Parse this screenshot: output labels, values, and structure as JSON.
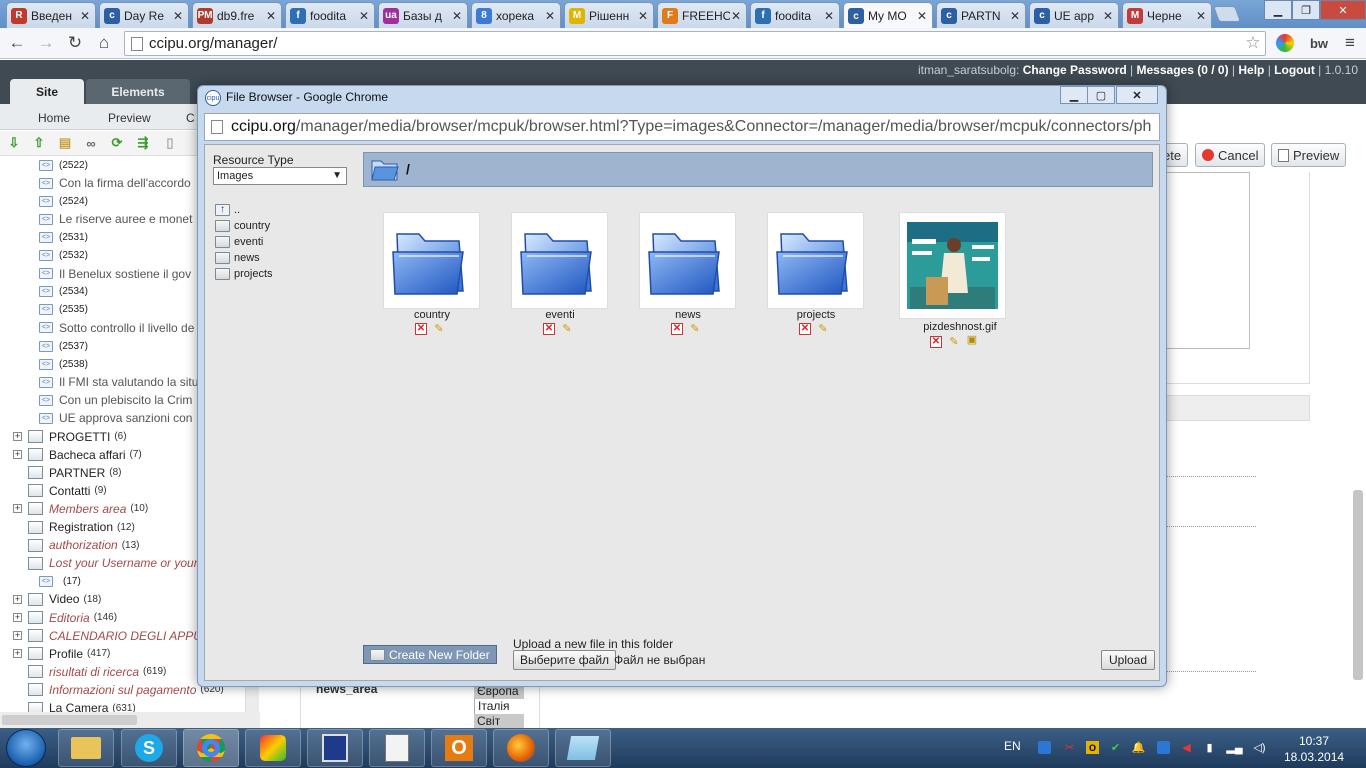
{
  "browser": {
    "tabs": [
      {
        "label": "Введен",
        "fav": "R",
        "color": "#c0392b"
      },
      {
        "label": "Day Re",
        "fav": "c",
        "color": "#2d5fa3"
      },
      {
        "label": "db9.fre",
        "fav": "РМ",
        "color": "#b03a2e"
      },
      {
        "label": "foodita",
        "fav": "f",
        "color": "#2d6fb3"
      },
      {
        "label": "Базы д",
        "fav": "ua",
        "color": "#a02f9e"
      },
      {
        "label": "хорека",
        "fav": "8",
        "color": "#3d7ad6"
      },
      {
        "label": "Рішенн",
        "fav": "M",
        "color": "#e2b400"
      },
      {
        "label": "FREEHO",
        "fav": "F",
        "color": "#e07b1c"
      },
      {
        "label": "foodita",
        "fav": "f",
        "color": "#2d6fb3"
      },
      {
        "label": "My MO",
        "fav": "c",
        "color": "#2d5fa3"
      },
      {
        "label": "PARTN",
        "fav": "c",
        "color": "#2d5fa3"
      },
      {
        "label": "UE app",
        "fav": "c",
        "color": "#2d5fa3"
      },
      {
        "label": "Черне",
        "fav": "M",
        "color": "#c23b3b"
      }
    ],
    "url": "ccipu.org/manager/"
  },
  "manager": {
    "user": "itman_saratsubolg:",
    "change_password": "Change Password",
    "messages": "Messages (0 / 0)",
    "help": "Help",
    "logout": "Logout",
    "version": "| 1.0.10",
    "tab_site": "Site",
    "tab_elements": "Elements",
    "sub_home": "Home",
    "sub_preview": "Preview",
    "sub_c": "C",
    "btn_delete_partial": "ete",
    "btn_cancel": "Cancel",
    "btn_preview": "Preview"
  },
  "tree": [
    {
      "type": "res",
      "label": "(2522)",
      "small": true
    },
    {
      "type": "res",
      "label": "Con la firma dell'accordo",
      "color": "#555"
    },
    {
      "type": "res",
      "label": "(2524)",
      "small": true
    },
    {
      "type": "res",
      "label": "Le riserve auree e monet",
      "color": "#555"
    },
    {
      "type": "res",
      "label": "(2531)",
      "small": true
    },
    {
      "type": "res",
      "label": "(2532)",
      "small": true
    },
    {
      "type": "res",
      "label": "Il Benelux sostiene il gov",
      "color": "#555"
    },
    {
      "type": "res",
      "label": "(2534)",
      "small": true
    },
    {
      "type": "res",
      "label": "(2535)",
      "small": true
    },
    {
      "type": "res",
      "label": "Sotto controllo il livello de",
      "color": "#555"
    },
    {
      "type": "res",
      "label": "(2537)",
      "small": true
    },
    {
      "type": "res",
      "label": "(2538)",
      "small": true
    },
    {
      "type": "res",
      "label": "Il FMI sta valutando la situ",
      "color": "#555"
    },
    {
      "type": "res",
      "label": "Con un plebiscito la Crim",
      "color": "#555"
    },
    {
      "type": "res",
      "label": "UE approva sanzioni con",
      "color": "#555"
    },
    {
      "type": "fold",
      "plus": true,
      "label": "PROGETTI",
      "count": "(6)"
    },
    {
      "type": "fold",
      "plus": true,
      "label": "Bacheca affari",
      "count": "(7)"
    },
    {
      "type": "fold",
      "plus": false,
      "label": "PARTNER",
      "count": "(8)"
    },
    {
      "type": "fold",
      "plus": false,
      "label": "Contatti",
      "count": "(9)"
    },
    {
      "type": "fold",
      "plus": true,
      "label": "Members area",
      "count": "(10)",
      "italic": true
    },
    {
      "type": "fold",
      "plus": false,
      "label": "Registration",
      "count": "(12)"
    },
    {
      "type": "fold",
      "plus": false,
      "label": "authorization",
      "count": "(13)",
      "italic": true
    },
    {
      "type": "fold",
      "plus": false,
      "label": "Lost your Username or your",
      "count": "",
      "italic": true
    },
    {
      "type": "res0",
      "label": "(17)",
      "small": true
    },
    {
      "type": "fold",
      "plus": true,
      "label": "Video",
      "count": "(18)"
    },
    {
      "type": "fold",
      "plus": true,
      "label": "Editoria",
      "count": "(146)",
      "italic": true
    },
    {
      "type": "fold",
      "plus": true,
      "label": "CALENDARIO DEGLI APPU",
      "count": "",
      "italic": true
    },
    {
      "type": "fold",
      "plus": true,
      "label": "Profile",
      "count": "(417)"
    },
    {
      "type": "fold",
      "plus": false,
      "label": "risultati di ricerca",
      "count": "(619)",
      "italic": true
    },
    {
      "type": "fold",
      "plus": false,
      "label": "Informazioni sul pagamento",
      "count": "(620)",
      "italic": true
    },
    {
      "type": "fold",
      "plus": false,
      "label": "La Camera",
      "count": "(631)"
    }
  ],
  "modal": {
    "title": "File Browser - Google Chrome",
    "url_host": "ccipu.org",
    "url_rest": "/manager/media/browser/mcpuk/browser.html?Type=images&Connector=/manager/media/browser/mcpuk/connectors/ph",
    "resource_type_label": "Resource Type",
    "resource_type_value": "Images",
    "folders": [
      "..",
      "country",
      "eventi",
      "news",
      "projects"
    ],
    "path": "/",
    "items": [
      {
        "name": "country",
        "kind": "folder"
      },
      {
        "name": "eventi",
        "kind": "folder"
      },
      {
        "name": "news",
        "kind": "folder"
      },
      {
        "name": "projects",
        "kind": "folder"
      },
      {
        "name": "pizdeshnost.gif",
        "kind": "image"
      }
    ],
    "create_folder": "Create New Folder",
    "upload_label": "Upload a new file in this folder",
    "choose_file": "Выберите файл",
    "no_file": "Файл не выбран",
    "upload": "Upload"
  },
  "underlay": {
    "news_area": "news_area",
    "options": [
      "Європа",
      "Італія",
      "Світ"
    ]
  },
  "taskbar": {
    "lang": "EN",
    "time": "10:37",
    "date": "18.03.2014"
  },
  "colors": {
    "accent_blue": "#3f7fd6",
    "header_dark": "#3f4a52",
    "italic_link": "#a34a4a"
  }
}
